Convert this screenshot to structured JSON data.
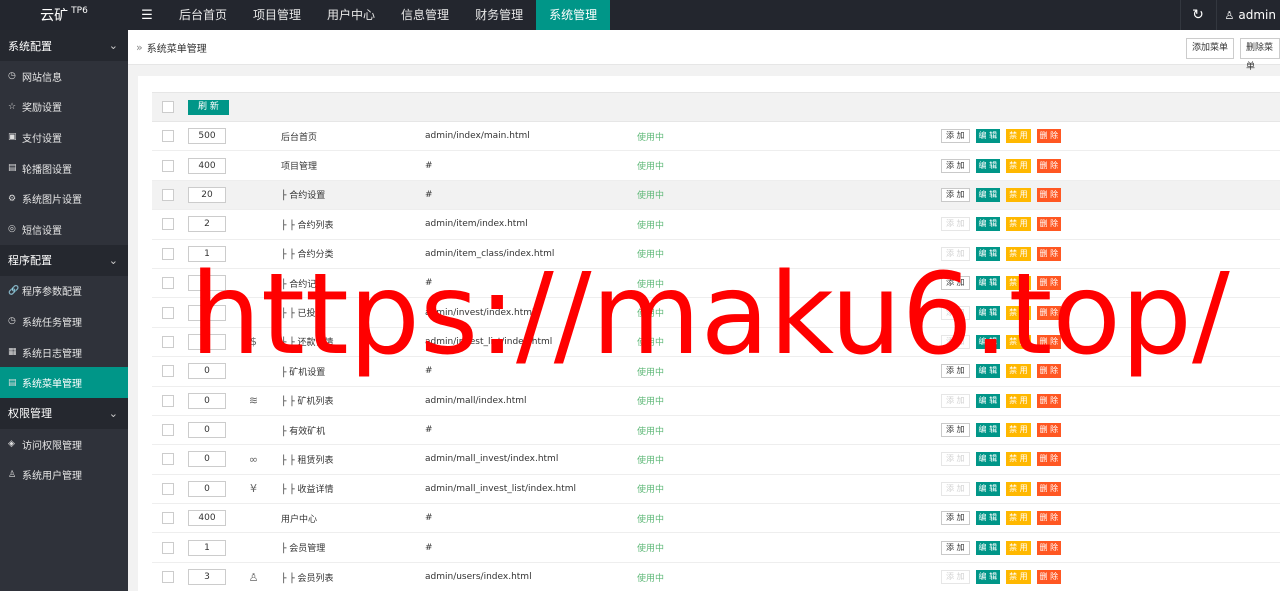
{
  "topbar": {
    "logo": "云矿",
    "logo_sup": "TP6",
    "menu_icon": "hamburger-icon",
    "nav": [
      "后台首页",
      "项目管理",
      "用户中心",
      "信息管理",
      "财务管理",
      "系统管理"
    ],
    "active_nav": "系统管理",
    "refresh_icon": "↻",
    "user": "admin"
  },
  "sidebar": {
    "groups": [
      {
        "label": "系统配置",
        "items": [
          {
            "icon": "◷",
            "label": "网站信息"
          },
          {
            "icon": "☆",
            "label": "奖励设置"
          },
          {
            "icon": "▣",
            "label": "支付设置"
          },
          {
            "icon": "▤",
            "label": "轮播图设置"
          },
          {
            "icon": "⚙",
            "label": "系统图片设置"
          },
          {
            "icon": "◎",
            "label": "短信设置"
          }
        ]
      },
      {
        "label": "程序配置",
        "items": [
          {
            "icon": "🔗",
            "label": "程序参数配置"
          },
          {
            "icon": "◷",
            "label": "系统任务管理"
          },
          {
            "icon": "▦",
            "label": "系统日志管理"
          },
          {
            "icon": "▤",
            "label": "系统菜单管理",
            "active": true
          }
        ]
      },
      {
        "label": "权限管理",
        "items": [
          {
            "icon": "◈",
            "label": "访问权限管理"
          },
          {
            "icon": "♙",
            "label": "系统用户管理"
          }
        ]
      }
    ]
  },
  "header": {
    "breadcrumb": "系统菜单管理",
    "add_button": "添加菜单",
    "delete_button": "删除菜单"
  },
  "table": {
    "refresh_button": "刷 新",
    "actions": {
      "add": "添 加",
      "edit": "编 辑",
      "disable": "禁 用",
      "delete": "删 除"
    },
    "rows": [
      {
        "sort": "500",
        "icon": "",
        "name": "后台首页",
        "url": "admin/index/main.html",
        "status": "使用中",
        "add_enabled": true
      },
      {
        "sort": "400",
        "icon": "",
        "name": "项目管理",
        "url": "#",
        "status": "使用中",
        "add_enabled": true
      },
      {
        "sort": "20",
        "icon": "",
        "name": "├ 合约设置",
        "url": "#",
        "status": "使用中",
        "add_enabled": true
      },
      {
        "sort": "2",
        "icon": "",
        "name": "├ ├ 合约列表",
        "url": "admin/item/index.html",
        "status": "使用中",
        "add_enabled": false
      },
      {
        "sort": "1",
        "icon": "",
        "name": "├ ├ 合约分类",
        "url": "admin/item_class/index.html",
        "status": "使用中",
        "add_enabled": false
      },
      {
        "sort": "",
        "icon": "",
        "name": "├ 合约记录",
        "url": "#",
        "status": "使用中",
        "add_enabled": true
      },
      {
        "sort": "",
        "icon": "",
        "name": "├ ├ 已投",
        "url": "admin/invest/index.html",
        "status": "使用中",
        "add_enabled": false
      },
      {
        "sort": "0",
        "icon": "$",
        "name": "├ ├ 还款详情",
        "url": "admin/invest_list/index.html",
        "status": "使用中",
        "add_enabled": false
      },
      {
        "sort": "0",
        "icon": "",
        "name": "├ 矿机设置",
        "url": "#",
        "status": "使用中",
        "add_enabled": true
      },
      {
        "sort": "0",
        "icon": "≋",
        "name": "├ ├ 矿机列表",
        "url": "admin/mall/index.html",
        "status": "使用中",
        "add_enabled": false
      },
      {
        "sort": "0",
        "icon": "",
        "name": "├ 有效矿机",
        "url": "#",
        "status": "使用中",
        "add_enabled": true
      },
      {
        "sort": "0",
        "icon": "∞",
        "name": "├ ├ 租赁列表",
        "url": "admin/mall_invest/index.html",
        "status": "使用中",
        "add_enabled": false
      },
      {
        "sort": "0",
        "icon": "¥",
        "name": "├ ├ 收益详情",
        "url": "admin/mall_invest_list/index.html",
        "status": "使用中",
        "add_enabled": false
      },
      {
        "sort": "400",
        "icon": "",
        "name": "用户中心",
        "url": "#",
        "status": "使用中",
        "add_enabled": true
      },
      {
        "sort": "1",
        "icon": "",
        "name": "├ 会员管理",
        "url": "#",
        "status": "使用中",
        "add_enabled": true
      },
      {
        "sort": "3",
        "icon": "♙",
        "name": "├ ├ 会员列表",
        "url": "admin/users/index.html",
        "status": "使用中",
        "add_enabled": false
      }
    ]
  },
  "watermark": "https://maku6.top/",
  "colors": {
    "accent": "#009688",
    "warn": "#FFB800",
    "danger": "#FF5722",
    "status": "#5FB878",
    "watermark": "#FF0000"
  }
}
